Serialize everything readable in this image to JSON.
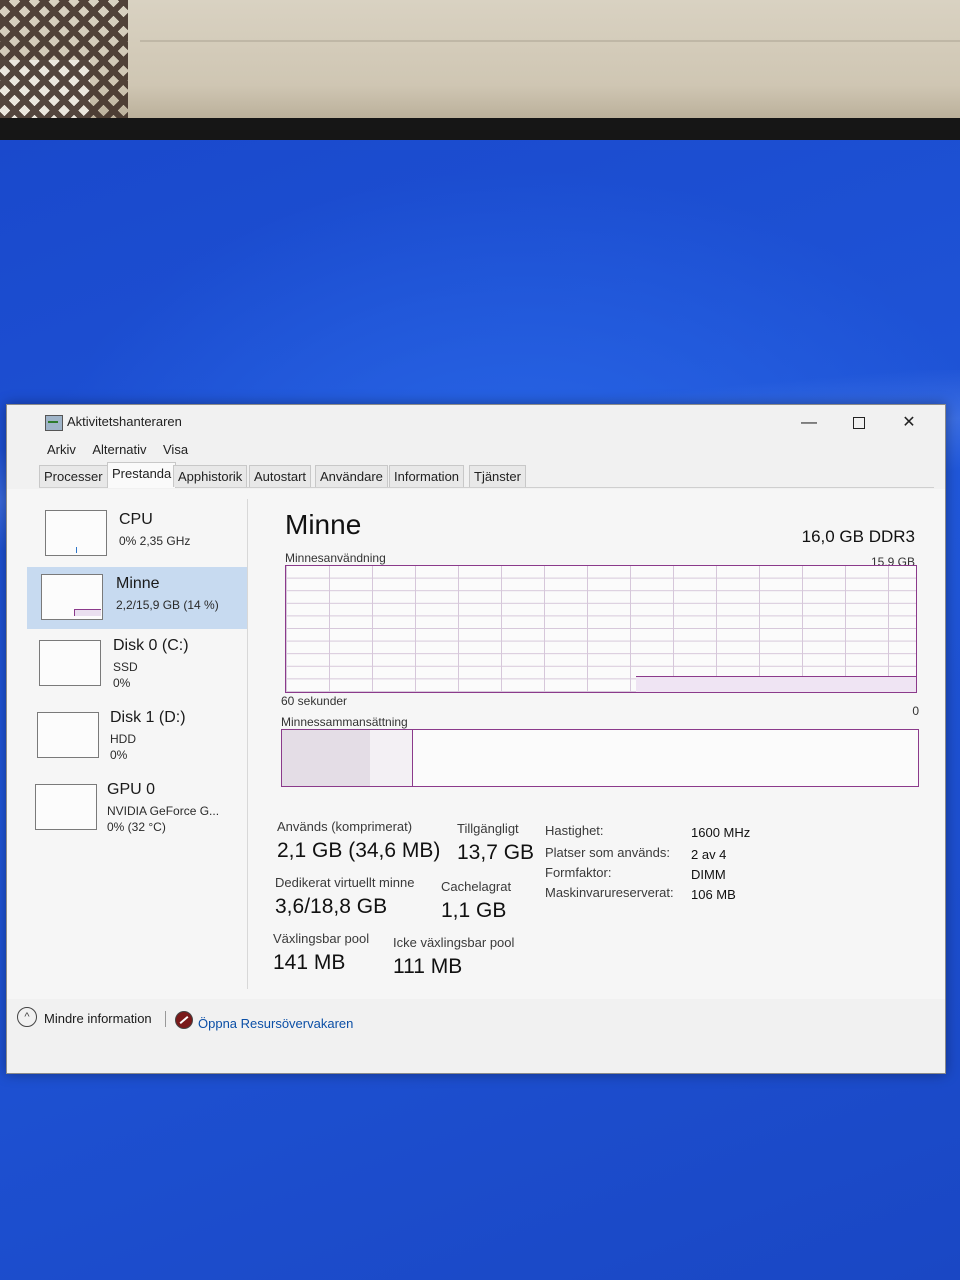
{
  "window": {
    "title": "Aktivitetshanteraren",
    "minimize_glyph": "—",
    "close_glyph": "✕"
  },
  "menu": [
    "Arkiv",
    "Alternativ",
    "Visa"
  ],
  "tabs": [
    "Processer",
    "Prestanda",
    "Apphistorik",
    "Autostart",
    "Användare",
    "Information",
    "Tjänster"
  ],
  "active_tab": "Prestanda",
  "sidebar": {
    "items": [
      {
        "name": "CPU",
        "lines": [
          "0% 2,35 GHz"
        ]
      },
      {
        "name": "Minne",
        "lines": [
          "2,2/15,9 GB (14 %)"
        ]
      },
      {
        "name": "Disk 0 (C:)",
        "lines": [
          "SSD",
          "0%"
        ]
      },
      {
        "name": "Disk 1 (D:)",
        "lines": [
          "HDD",
          "0%"
        ]
      },
      {
        "name": "GPU 0",
        "lines": [
          "NVIDIA GeForce G...",
          "0% (32 °C)"
        ]
      }
    ],
    "selected": "Minne"
  },
  "memory": {
    "title": "Minne",
    "spec": "16,0 GB DDR3",
    "usage_label": "Minnesanvändning",
    "usage_max": "15,9 GB",
    "time_label": "60 sekunder",
    "zero_label": "0",
    "composition_label": "Minnessammansättning",
    "stats": {
      "in_use_label": "Används (komprimerat)",
      "in_use_value": "2,1 GB (34,6 MB)",
      "available_label": "Tillgängligt",
      "available_value": "13,7 GB",
      "committed_label": "Dedikerat virtuellt minne",
      "committed_value": "3,6/18,8 GB",
      "cached_label": "Cachelagrat",
      "cached_value": "1,1 GB",
      "paged_label": "Växlingsbar pool",
      "paged_value": "141 MB",
      "nonpaged_label": "Icke växlingsbar pool",
      "nonpaged_value": "111 MB"
    },
    "details": [
      {
        "label": "Hastighet:",
        "value": "1600 MHz"
      },
      {
        "label": "Platser som används:",
        "value": "2 av 4"
      },
      {
        "label": "Formfaktor:",
        "value": "DIMM"
      },
      {
        "label": "Maskinvarureserverat:",
        "value": "106 MB"
      }
    ]
  },
  "footer": {
    "fewer_details": "Mindre information",
    "open_resource_monitor": "Öppna Resursövervakaren"
  },
  "icons": {
    "app": "task-manager-icon",
    "fewer": "chevron-up-icon",
    "resmon": "resource-monitor-icon"
  },
  "colors": {
    "memory_accent": "#8b3a8b",
    "selected_item": "#c7daf0",
    "link": "#0b4fa6",
    "desktop": "#1d4fd0"
  }
}
